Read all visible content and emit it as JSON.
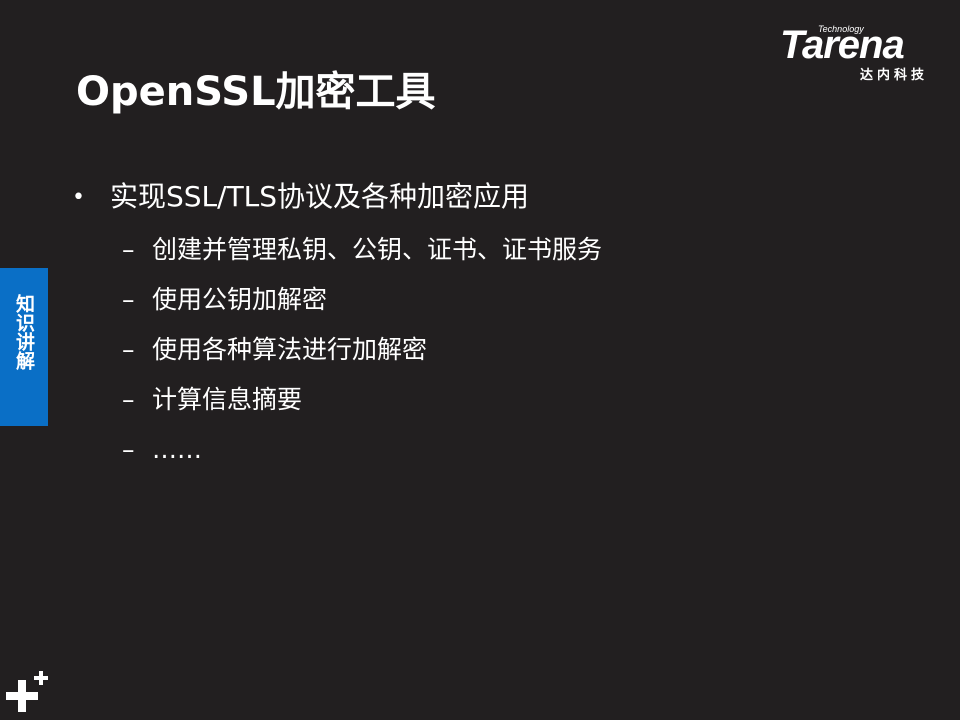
{
  "logo": {
    "tech_text": "Technology",
    "brand_text": "Tarena",
    "sub_text": "达内科技"
  },
  "slide": {
    "title": "OpenSSL加密工具",
    "main_bullet": {
      "marker": "•",
      "text": "实现SSL/TLS协议及各种加密应用"
    },
    "sub_items": [
      {
        "marker": "–",
        "text": "创建并管理私钥、公钥、证书、证书服务"
      },
      {
        "marker": "–",
        "text": "使用公钥加解密"
      },
      {
        "marker": "–",
        "text": "使用各种算法进行加解密"
      },
      {
        "marker": "–",
        "text": "计算信息摘要"
      },
      {
        "marker": "–",
        "text": "……"
      }
    ]
  },
  "side_tab": {
    "text": "知识讲解"
  },
  "decor": {
    "icon": "plus-icon"
  },
  "colors": {
    "background": "#221f20",
    "side_tab": "#0a6fc6",
    "text": "#ffffff"
  }
}
